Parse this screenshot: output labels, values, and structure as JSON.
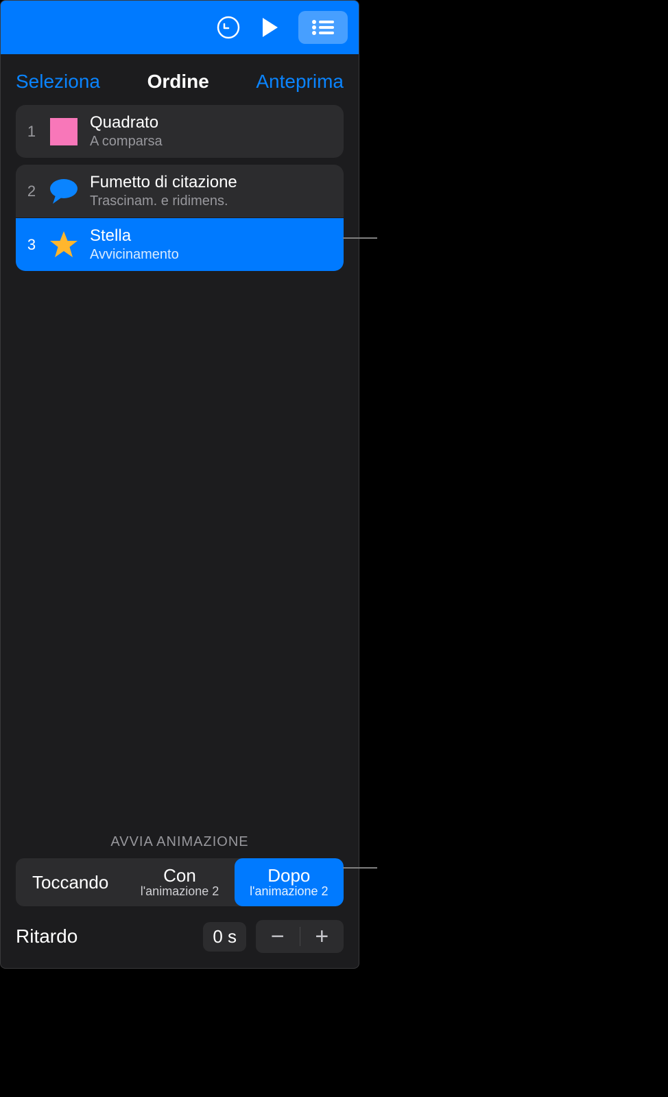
{
  "tabs": {
    "left": "Seleziona",
    "center": "Ordine",
    "right": "Anteprima"
  },
  "items": [
    {
      "number": "1",
      "title": "Quadrato",
      "subtitle": "A comparsa",
      "icon": "square"
    },
    {
      "number": "2",
      "title": "Fumetto di citazione",
      "subtitle": "Trascinam. e ridimens.",
      "icon": "bubble"
    },
    {
      "number": "3",
      "title": "Stella",
      "subtitle": "Avvicinamento",
      "icon": "star",
      "selected": true
    }
  ],
  "footer": {
    "section_label": "AVVIA ANIMAZIONE",
    "options": {
      "tap": "Toccando",
      "with_main": "Con",
      "with_sub": "l'animazione 2",
      "after_main": "Dopo",
      "after_sub": "l'animazione 2"
    },
    "delay_label": "Ritardo",
    "delay_value": "0 s"
  }
}
